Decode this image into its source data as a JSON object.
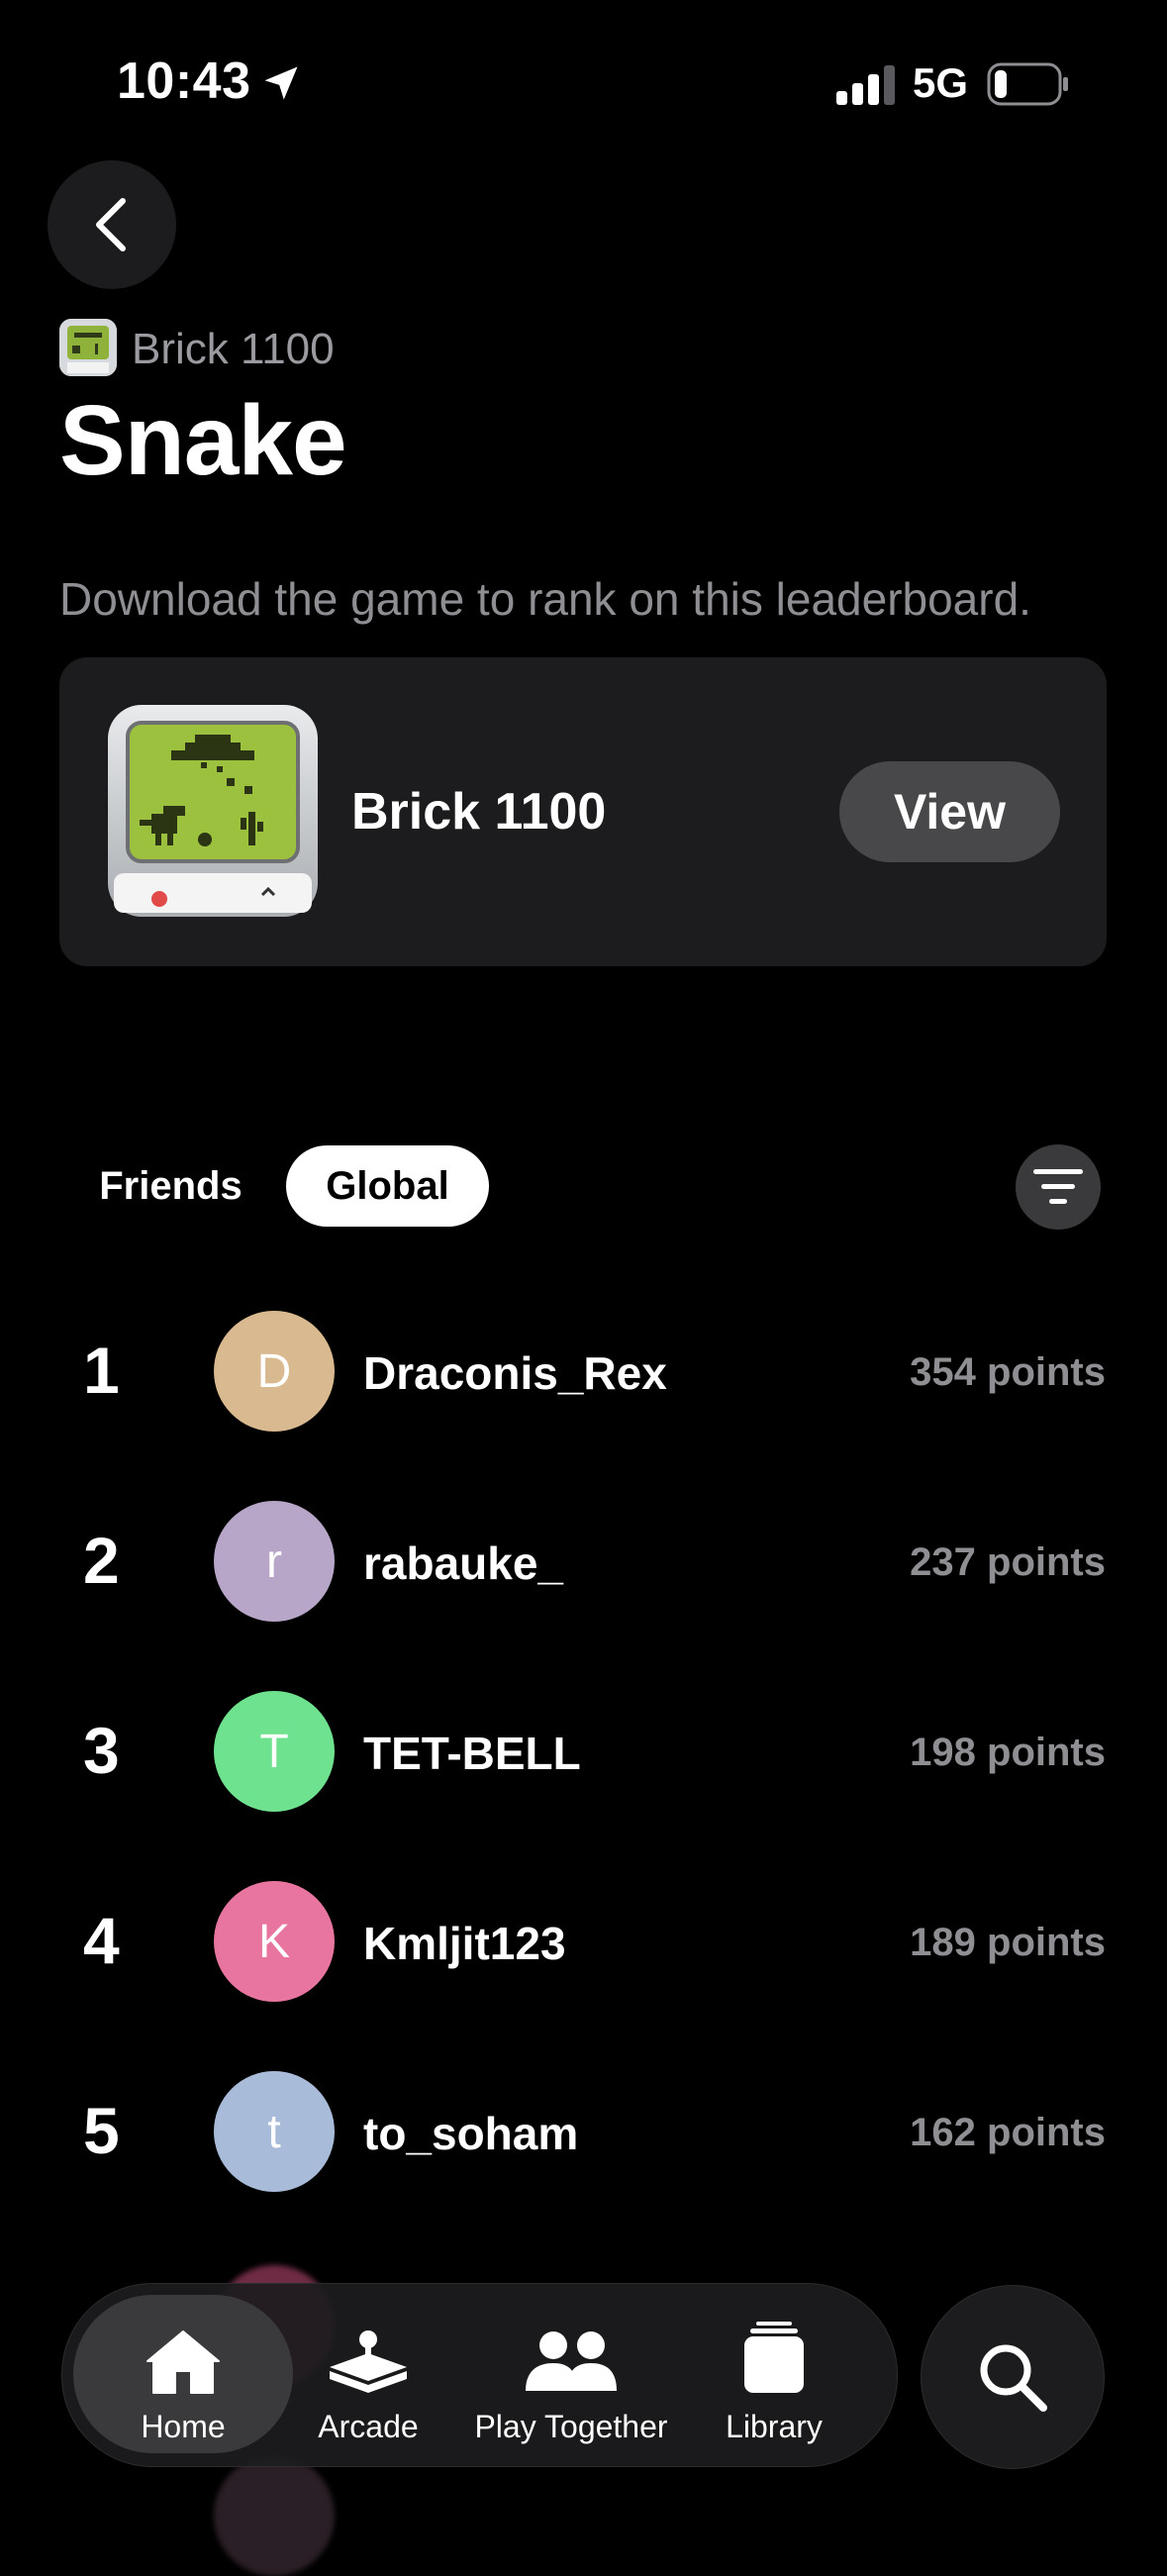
{
  "status": {
    "time": "10:43",
    "network": "5G",
    "battery_level": 0.15
  },
  "header": {
    "breadcrumb": "Brick 1100",
    "title": "Snake",
    "hint": "Download the game to rank on this leaderboard."
  },
  "game_card": {
    "name": "Brick 1100",
    "button": "View"
  },
  "tabs": {
    "friends": "Friends",
    "global": "Global",
    "selected": "Global"
  },
  "leaderboard": [
    {
      "rank": "1",
      "initial": "D",
      "name": "Draconis_Rex",
      "points": "354 points",
      "color": "#d9b98f"
    },
    {
      "rank": "2",
      "initial": "r",
      "name": "rabauke_",
      "points": "237 points",
      "color": "#b8a6c9"
    },
    {
      "rank": "3",
      "initial": "T",
      "name": "TET-BELL",
      "points": "198 points",
      "color": "#6fe28f"
    },
    {
      "rank": "4",
      "initial": "K",
      "name": "Kmljit123",
      "points": "189 points",
      "color": "#e8759f"
    },
    {
      "rank": "5",
      "initial": "t",
      "name": "to_soham",
      "points": "162 points",
      "color": "#a8bcd9"
    }
  ],
  "nav": {
    "home": "Home",
    "arcade": "Arcade",
    "play_together": "Play Together",
    "library": "Library",
    "active": "Home"
  },
  "colors": {
    "background": "#000000",
    "card": "#1c1c1e",
    "secondary_text": "#8e8e93"
  }
}
